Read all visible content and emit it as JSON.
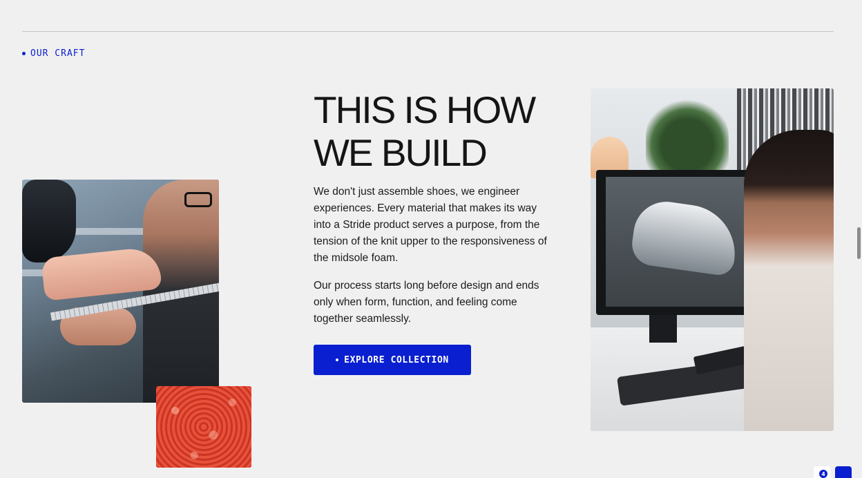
{
  "section": {
    "eyebrow": "OUR CRAFT",
    "headline_line1": "THIS IS HOW",
    "headline_line2": "WE BUILD",
    "paragraph1": "We don't just assemble shoes, we engineer experiences. Every material that makes its way into a Stride product serves a purpose, from the tension of the knit upper to the responsiveness of the midsole foam.",
    "paragraph2": "Our process starts long before design and ends only when form, function, and feeling come together seamlessly.",
    "cta_label": "EXPLORE COLLECTION"
  },
  "images": {
    "left": "craftsman-measuring-shoe-last-photo",
    "texture": "red-knit-material-closeup-photo",
    "right": "designer-3d-shoe-modeling-photo"
  },
  "widget": {
    "badge_count": "4"
  },
  "colors": {
    "accent": "#0a1fcf",
    "background": "#f1f0f0",
    "text": "#151515"
  }
}
